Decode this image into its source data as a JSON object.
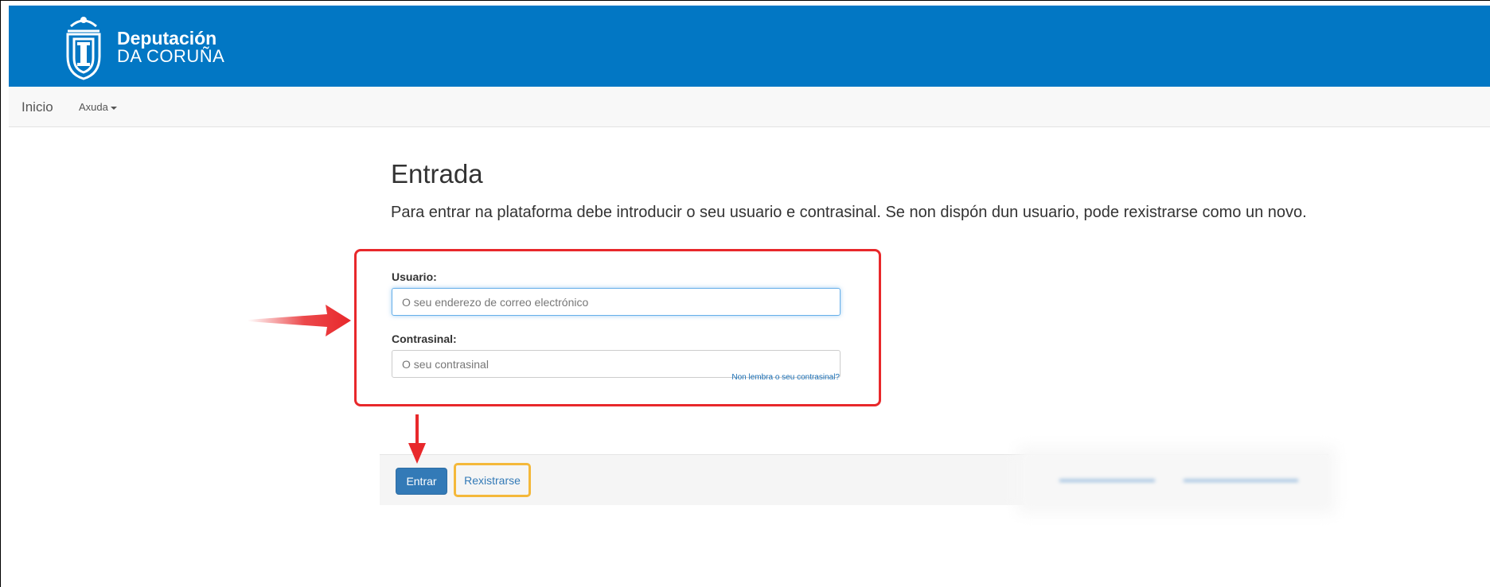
{
  "header": {
    "logo_line1": "Deputación",
    "logo_line2": "DA CORUÑA",
    "background_color": "#0277c4",
    "logo_icon": "shield-crest-icon"
  },
  "navbar": {
    "inicio_label": "Inicio",
    "axuda_label": "Axuda"
  },
  "main": {
    "title": "Entrada",
    "intro": "Para entrar na plataforma debe introducir o seu usuario e contrasinal. Se non dispón dun usuario, pode rexistrarse como un novo."
  },
  "form": {
    "usuario_label": "Usuario:",
    "usuario_placeholder": "O seu enderezo de correo electrónico",
    "usuario_value": "",
    "contrasinal_label": "Contrasinal:",
    "contrasinal_placeholder": "O seu contrasinal",
    "contrasinal_value": "",
    "forgot_link": "Non lembra o seu contrasinal?"
  },
  "actions": {
    "entrar_label": "Entrar",
    "rexistrarse_label": "Rexistrarse"
  },
  "annotations": {
    "highlight_box_color": "#e8282b",
    "register_highlight_color": "#f4b83a",
    "arrow_color": "#e8282b"
  }
}
